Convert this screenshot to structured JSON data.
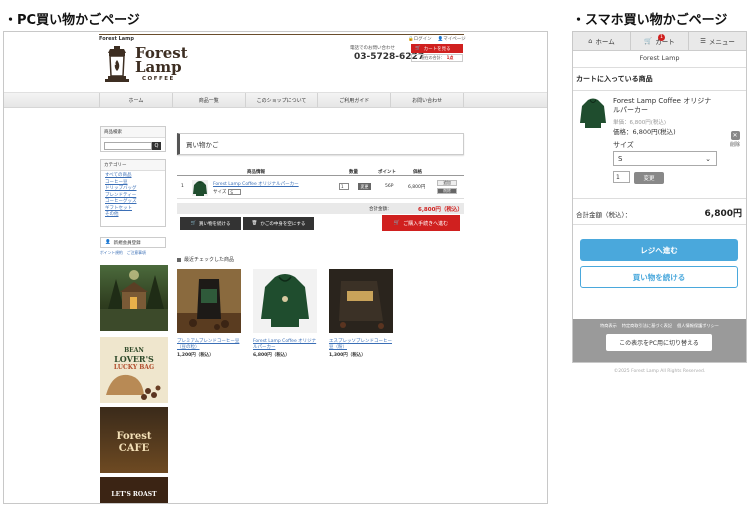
{
  "headings": {
    "pc": "・PC買い物かごページ",
    "sp": "・スマホ買い物かごページ"
  },
  "pc": {
    "brand_small": "Forest Lamp",
    "logo": {
      "forest": "Forest",
      "lamp": "Lamp",
      "coffee": "COFFEE"
    },
    "tel_label": "電話でのお問い合わせ",
    "tel_number": "03-5728-6227",
    "toplinks": {
      "login": "ログイン",
      "mypage": "マイページ"
    },
    "cart_button": "カートを見る",
    "cart_summary_label": "現在の合計：",
    "cart_summary_value": "1点",
    "nav": [
      "ホーム",
      "商品一覧",
      "このショップについて",
      "ご利用ガイド",
      "お問い合わせ"
    ],
    "sidebar": {
      "search_title": "商品検索",
      "search_button": "Q",
      "category_title": "カテゴリー",
      "categories": [
        "すべての商品",
        "コーヒー豆",
        "ドリップバッグ",
        "ブレンドティー",
        "コーヒーグッズ",
        "ギフトセット",
        "その他"
      ],
      "member_button": "新規会員登録",
      "links": [
        "ポイント規約",
        "ご注意事項"
      ],
      "banners": {
        "b2_line1": "BEAN",
        "b2_line2": "LOVER'S",
        "b2_line3": "LUCKY BAG",
        "b3_line1": "Forest",
        "b3_line2": "CAFE",
        "b4_line1": "LET'S ROAST"
      }
    },
    "cart": {
      "title": "買い物かご",
      "headers": {
        "product": "商品情報",
        "qty": "数量",
        "points": "ポイント",
        "price": "価格"
      },
      "row": {
        "index": "1",
        "name": "Forest Lamp Coffee オリジナルパーカー",
        "size_label": "サイズ",
        "size_value": "S",
        "qty": "1",
        "qty_button": "変更",
        "points": "56P",
        "price": "6,800円",
        "action_edit": "追加",
        "action_delete": "削除"
      },
      "total_label": "合計金額：",
      "total_value": "6,800円（税込）",
      "continue_button": "買い物を続ける",
      "clear_button": "かごの中身を空にする",
      "checkout_button": "ご購入手続きへ進む"
    },
    "recent": {
      "title": "最近チェックした商品",
      "items": [
        {
          "name": "プレミアムブレンドコーヒー豆（豆の粒）",
          "price": "1,200円（税込）"
        },
        {
          "name": "Forest Lamp Coffee オリジナルパーカー",
          "price": "6,800円（税込）"
        },
        {
          "name": "エスプレッソブレンドコーヒー豆（粉）",
          "price": "1,300円（税込）"
        }
      ]
    }
  },
  "sp": {
    "tabs": {
      "home": "ホーム",
      "cart": "カート",
      "cart_badge": "1",
      "menu": "メニュー"
    },
    "brand": "Forest Lamp",
    "section_title": "カートに入っている商品",
    "item": {
      "name": "Forest Lamp Coffee オリジナルパーカー",
      "unit_price": "単価：6,800円(税込)",
      "price": "価格：6,800円(税込)",
      "delete": "削除",
      "size_label": "サイズ",
      "size_value": "S",
      "qty": "1",
      "change": "変更"
    },
    "sum_label": "合計金額（税込）：",
    "sum_value": "6,800円",
    "register_button": "レジへ進む",
    "continue_button": "買い物を続ける",
    "footer_links": [
      "特商表示",
      "特定商取引法に基づく表記",
      "個人情報保護ポリシー"
    ],
    "pc_switch": "この表示をPC用に切り替える",
    "copyright": "©2025 Forest Lamp All Rights Reserved."
  },
  "colors": {
    "accent_red": "#d0201f",
    "accent_blue": "#4aa8dc",
    "hoodie_green": "#1f4d2e"
  }
}
